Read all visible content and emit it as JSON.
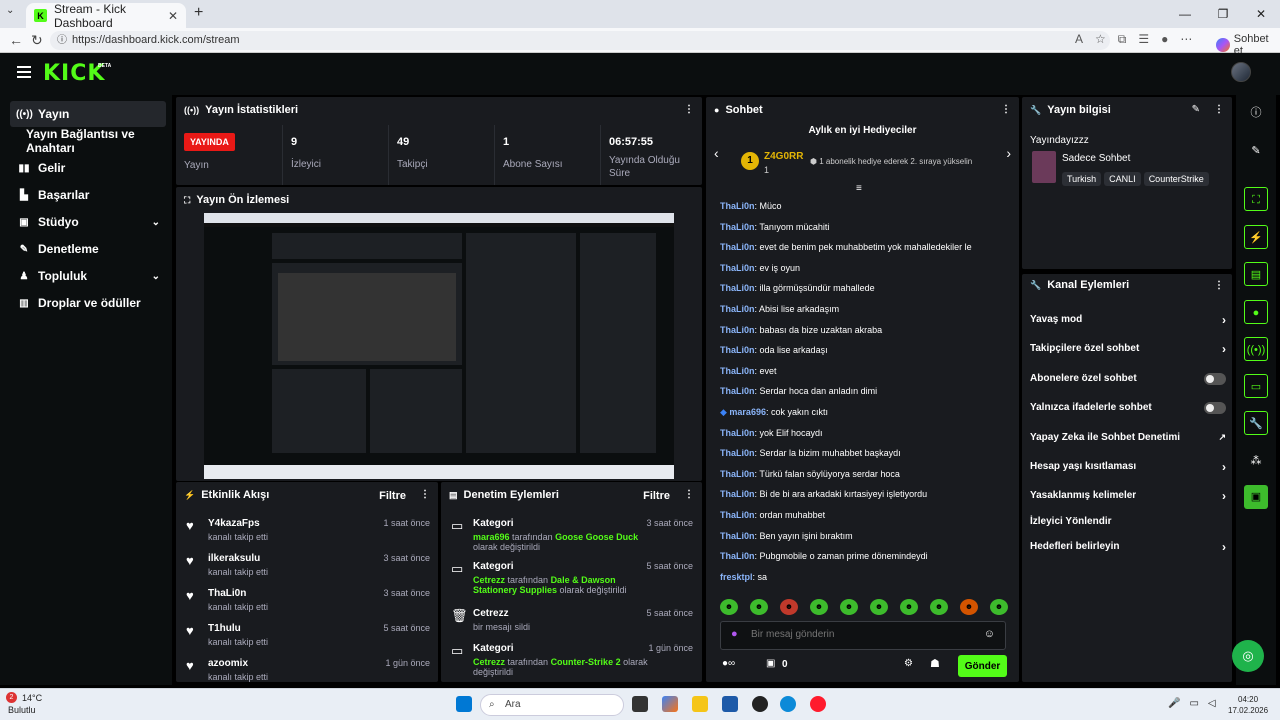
{
  "browser": {
    "tab_title": "Stream - Kick Dashboard",
    "url": "https://dashboard.kick.com/stream",
    "copilot_label": "Sohbet et"
  },
  "header": {
    "logo": "KICK",
    "beta": "BETA"
  },
  "sidebar": {
    "items": [
      {
        "label": "Yayın",
        "icon": "stream-icon"
      },
      {
        "label": "Yayın Bağlantısı ve Anahtarı",
        "icon": ""
      },
      {
        "label": "Gelir",
        "icon": "revenue-icon"
      },
      {
        "label": "Başarılar",
        "icon": "achievements-icon"
      },
      {
        "label": "Stüdyo",
        "icon": "studio-icon"
      },
      {
        "label": "Denetleme",
        "icon": "moderation-icon"
      },
      {
        "label": "Topluluk",
        "icon": "community-icon"
      },
      {
        "label": "Droplar ve ödüller",
        "icon": "drops-icon"
      }
    ]
  },
  "stats": {
    "title": "Yayın İstatistikleri",
    "live_badge": "YAYINDA",
    "items": [
      {
        "value": "",
        "label": "Yayın"
      },
      {
        "value": "9",
        "label": "İzleyici"
      },
      {
        "value": "49",
        "label": "Takipçi"
      },
      {
        "value": "1",
        "label": "Abone Sayısı"
      },
      {
        "value": "06:57:55",
        "label": "Yayında Olduğu Süre"
      }
    ]
  },
  "preview": {
    "title": "Yayın Ön İzlemesi"
  },
  "activity": {
    "title": "Etkinlik Akışı",
    "filter": "Filtre",
    "items": [
      {
        "name": "Y4kazaFps",
        "sub": "kanalı takip etti",
        "time": "1 saat önce"
      },
      {
        "name": "ilkeraksulu",
        "sub": "kanalı takip etti",
        "time": "3 saat önce"
      },
      {
        "name": "ThaLi0n",
        "sub": "kanalı takip etti",
        "time": "3 saat önce"
      },
      {
        "name": "T1hulu",
        "sub": "kanalı takip etti",
        "time": "5 saat önce"
      },
      {
        "name": "azoomix",
        "sub": "kanalı takip etti",
        "time": "1 gün önce"
      }
    ]
  },
  "moderation": {
    "title": "Denetim Eylemleri",
    "filter": "Filtre",
    "items": [
      {
        "name": "Kategori",
        "actor": "mara696",
        "mid": " tarafından ",
        "target": "Goose Goose Duck",
        "tail": " olarak değiştirildi",
        "time": "3 saat önce"
      },
      {
        "name": "Kategori",
        "actor": "Cetrezz",
        "mid": " tarafından ",
        "target": "Dale & Dawson Stationery Supplies",
        "tail": " olarak değiştirildi",
        "time": "5 saat önce"
      },
      {
        "name": "Cetrezz",
        "actor": "",
        "mid": "bir mesajı sildi",
        "target": "",
        "tail": "",
        "time": "5 saat önce"
      },
      {
        "name": "Kategori",
        "actor": "Cetrezz",
        "mid": " tarafından ",
        "target": "Counter-Strike 2",
        "tail": " olarak değiştirildi",
        "time": "1 gün önce"
      }
    ]
  },
  "chat": {
    "title": "Sohbet",
    "gifters_title": "Aylık en iyi Hediyeciler",
    "top_gifter": "Z4G0RR",
    "top_gifter_count": "1",
    "gift_note": "1 abonelik hediye ederek 2. sıraya yükselin",
    "messages": [
      {
        "user": "ThaLi0n",
        "text": "Müco"
      },
      {
        "user": "ThaLi0n",
        "text": "Tanıyom mücahiti"
      },
      {
        "user": "ThaLi0n",
        "text": "evet de benim pek muhabbetim yok mahalledekiler le"
      },
      {
        "user": "ThaLi0n",
        "text": "ev iş oyun"
      },
      {
        "user": "ThaLi0n",
        "text": "illa görmüşsündür mahallede"
      },
      {
        "user": "ThaLi0n",
        "text": "Abisi lise arkadaşım"
      },
      {
        "user": "ThaLi0n",
        "text": "babası da bize uzaktan akraba"
      },
      {
        "user": "ThaLi0n",
        "text": "oda lise arkadaşı"
      },
      {
        "user": "ThaLi0n",
        "text": "evet"
      },
      {
        "user": "ThaLi0n",
        "text": "Serdar hoca dan anladın dimi"
      },
      {
        "user": "mara696",
        "text": "cok yakın cıktı"
      },
      {
        "user": "ThaLi0n",
        "text": "yok Elif hocaydı"
      },
      {
        "user": "ThaLi0n",
        "text": "Serdar la bizim muhabbet başkaydı"
      },
      {
        "user": "ThaLi0n",
        "text": "Türkü falan söylüyorya serdar hoca"
      },
      {
        "user": "ThaLi0n",
        "text": "Bi de bi ara arkadaki kırtasiyeyi işletiyordu"
      },
      {
        "user": "ThaLi0n",
        "text": "ordan muhabbet"
      },
      {
        "user": "ThaLi0n",
        "text": "Ben yayın işini bıraktım"
      },
      {
        "user": "ThaLi0n",
        "text": "Pubgmobile o zaman prime dönemindeydi"
      },
      {
        "user": "fresktpl",
        "text": "sa"
      }
    ],
    "input_placeholder": "Bir mesaj gönderin",
    "points": "0",
    "send_label": "Gönder"
  },
  "stream_info": {
    "title": "Yayın bilgisi",
    "stream_title": "Yayındayızzz",
    "notice": "Sadece Sohbet",
    "tags": [
      "Turkish",
      "CANLI",
      "CounterStrike"
    ]
  },
  "channel_actions": {
    "title": "Kanal Eylemleri",
    "items": [
      {
        "label": "Yavaş mod",
        "kind": "chevron"
      },
      {
        "label": "Takipçilere özel sohbet",
        "kind": "chevron"
      },
      {
        "label": "Abonelere özel sohbet",
        "kind": "toggle"
      },
      {
        "label": "Yalnızca ifadelerle sohbet",
        "kind": "toggle"
      },
      {
        "label": "Yapay Zeka ile Sohbet Denetimi",
        "kind": "external"
      },
      {
        "label": "Hesap yaşı kısıtlaması",
        "kind": "chevron"
      },
      {
        "label": "Yasaklanmış kelimeler",
        "kind": "chevron"
      },
      {
        "label": "İzleyici Yönlendir",
        "kind": "none"
      },
      {
        "label": "Hedefleri belirleyin",
        "kind": "chevron"
      }
    ]
  },
  "taskbar": {
    "temp": "14°C",
    "weather": "Bulutlu",
    "badge": "2",
    "search": "Ara",
    "time": "04:20",
    "date": "17.02.2026"
  },
  "colors": {
    "accent": "#53fc18",
    "live": "#e91916",
    "panel": "#191b1f",
    "bg": "#000000"
  }
}
